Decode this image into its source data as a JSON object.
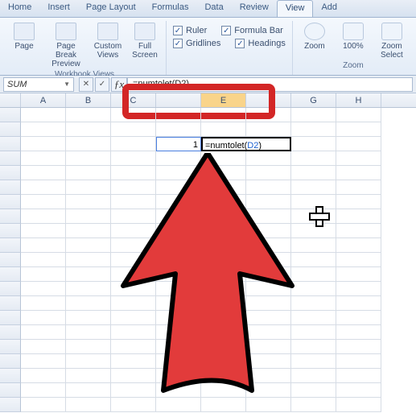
{
  "tabs": {
    "home": "Home",
    "insert": "Insert",
    "pagelayout": "Page Layout",
    "formulas": "Formulas",
    "data": "Data",
    "review": "Review",
    "view": "View",
    "add": "Add"
  },
  "ribbon": {
    "views_group_label": "Workbook Views",
    "page": "Page",
    "pagebreak": "Page Break Preview",
    "custom": "Custom Views",
    "full": "Full Screen",
    "ruler": "Ruler",
    "formulabar": "Formula Bar",
    "gridlines": "Gridlines",
    "headings": "Headings",
    "zoom_group_label": "Zoom",
    "zoom": "Zoom",
    "hundred": "100%",
    "zoomsel": "Zoom Select"
  },
  "namebox": {
    "value": "SUM"
  },
  "formula_bar": {
    "value": "=numtolet(D2)"
  },
  "columns": {
    "a": "A",
    "b": "B",
    "c": "C",
    "e": "E",
    "g": "G",
    "h": "H"
  },
  "cells": {
    "d2_value": "1",
    "e2_prefix": "=numtolet(",
    "e2_ref": "D2",
    "e2_suffix": ")"
  }
}
